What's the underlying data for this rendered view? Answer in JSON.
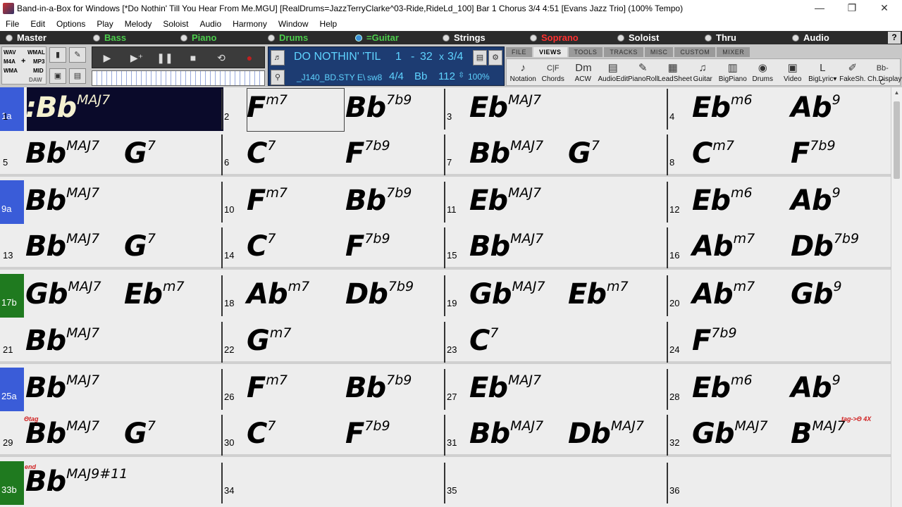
{
  "window": {
    "title": "Band-in-a-Box for Windows  [*Do Nothin' Till You Hear From Me.MGU] [RealDrums=JazzTerryClarke^03-Ride,RideLd_100] Bar 1 Chorus 3/4   4:51  [Evans Jazz Trio] (100% Tempo)",
    "minimize": "—",
    "restore": "❐",
    "close": "✕"
  },
  "menu": [
    "File",
    "Edit",
    "Options",
    "Play",
    "Melody",
    "Soloist",
    "Audio",
    "Harmony",
    "Window",
    "Help"
  ],
  "tracks": [
    {
      "label": "Master",
      "color": "#ffffff",
      "selected": false
    },
    {
      "label": "Bass",
      "color": "#4ccd4c",
      "selected": false
    },
    {
      "label": "Piano",
      "color": "#4ccd4c",
      "selected": false
    },
    {
      "label": "Drums",
      "color": "#4ccd4c",
      "selected": false
    },
    {
      "label": "=Guitar",
      "color": "#4ccd4c",
      "selected": true
    },
    {
      "label": "Strings",
      "color": "#ffffff",
      "selected": false
    },
    {
      "label": "Soprano",
      "color": "#ff3030",
      "selected": false
    },
    {
      "label": "Soloist",
      "color": "#ffffff",
      "selected": false
    },
    {
      "label": "Thru",
      "color": "#ffffff",
      "selected": false
    },
    {
      "label": "Audio",
      "color": "#ffffff",
      "selected": false
    }
  ],
  "help": "?",
  "formats": {
    "wav": "WAV",
    "wmal": "WMAL",
    "m4a": "M4A",
    "mp3": "MP3",
    "wma": "WMA",
    "mid": "MID",
    "daw": "DAW",
    "plus": "+"
  },
  "song": {
    "title": "DO NOTHIN' 'TIL",
    "bar_start": "1",
    "dash": "-",
    "bar_end": "32",
    "times": "x",
    "choruses": "3/4",
    "style": "_J140_BD.STY E\\",
    "style_var": "sw8",
    "time_sig": "4/4",
    "key": "Bb",
    "tempo": "112",
    "tempo_pct": "100%"
  },
  "tabs": [
    "FILE",
    "VIEWS",
    "TOOLS",
    "TRACKS",
    "MISC",
    "CUSTOM",
    "MIXER"
  ],
  "active_tab": "VIEWS",
  "views": [
    {
      "label": "Notation",
      "icon": "♪",
      "name": "notation-icon"
    },
    {
      "label": "Chords",
      "icon": "C|F",
      "name": "chords-icon"
    },
    {
      "label": "ACW",
      "icon": "Dm",
      "name": "acw-icon"
    },
    {
      "label": "AudioEdit",
      "icon": "▤",
      "name": "audioedit-icon"
    },
    {
      "label": "PianoRoll",
      "icon": "✎",
      "name": "pianoroll-icon"
    },
    {
      "label": "LeadSheet",
      "icon": "▦",
      "name": "leadsheet-icon"
    },
    {
      "label": "Guitar",
      "icon": "♫",
      "name": "guitar-icon"
    },
    {
      "label": "BigPiano",
      "icon": "▥",
      "name": "bigpiano-icon"
    },
    {
      "label": "Drums",
      "icon": "◉",
      "name": "drums-icon"
    },
    {
      "label": "Video",
      "icon": "▣",
      "name": "video-icon"
    },
    {
      "label": "BigLyric▾",
      "icon": "L",
      "name": "biglyric-icon"
    },
    {
      "label": "FakeSh.",
      "icon": "✐",
      "name": "fakesheet-icon"
    },
    {
      "label": "Ch.Display▾",
      "icon": "Bb-C",
      "name": "chord-display-icon"
    }
  ],
  "sheet": {
    "rows": [
      {
        "label": "1a",
        "label_color": "#3a5cd8",
        "bars": [
          {
            "num": "1",
            "chords": [
              {
                "root": ":Bb",
                "ext": "MAJ7"
              }
            ]
          },
          {
            "num": "2",
            "chords": [
              {
                "root": "F",
                "ext": "m7"
              },
              {
                "root": "Bb",
                "ext": "7b9"
              }
            ]
          },
          {
            "num": "3",
            "chords": [
              {
                "root": "Eb",
                "ext": "MAJ7"
              }
            ]
          },
          {
            "num": "4",
            "chords": [
              {
                "root": "Eb",
                "ext": "m6"
              },
              {
                "root": "Ab",
                "ext": "9"
              }
            ]
          }
        ]
      },
      {
        "label": "",
        "label_color": "",
        "bars": [
          {
            "num": "5",
            "chords": [
              {
                "root": "Bb",
                "ext": "MAJ7"
              },
              {
                "root": "G",
                "ext": "7"
              }
            ]
          },
          {
            "num": "6",
            "chords": [
              {
                "root": "C",
                "ext": "7"
              },
              {
                "root": "F",
                "ext": "7b9"
              }
            ]
          },
          {
            "num": "7",
            "chords": [
              {
                "root": "Bb",
                "ext": "MAJ7"
              },
              {
                "root": "G",
                "ext": "7"
              }
            ]
          },
          {
            "num": "8",
            "chords": [
              {
                "root": "C",
                "ext": "m7"
              },
              {
                "root": "F",
                "ext": "7b9"
              }
            ]
          }
        ]
      },
      {
        "label": "9a",
        "label_color": "#3a5cd8",
        "bars": [
          {
            "num": "",
            "chords": [
              {
                "root": "Bb",
                "ext": "MAJ7"
              }
            ]
          },
          {
            "num": "10",
            "chords": [
              {
                "root": "F",
                "ext": "m7"
              },
              {
                "root": "Bb",
                "ext": "7b9"
              }
            ]
          },
          {
            "num": "11",
            "chords": [
              {
                "root": "Eb",
                "ext": "MAJ7"
              }
            ]
          },
          {
            "num": "12",
            "chords": [
              {
                "root": "Eb",
                "ext": "m6"
              },
              {
                "root": "Ab",
                "ext": "9"
              }
            ]
          }
        ]
      },
      {
        "label": "",
        "label_color": "",
        "bars": [
          {
            "num": "13",
            "chords": [
              {
                "root": "Bb",
                "ext": "MAJ7"
              },
              {
                "root": "G",
                "ext": "7"
              }
            ]
          },
          {
            "num": "14",
            "chords": [
              {
                "root": "C",
                "ext": "7"
              },
              {
                "root": "F",
                "ext": "7b9"
              }
            ]
          },
          {
            "num": "15",
            "chords": [
              {
                "root": "Bb",
                "ext": "MAJ7"
              }
            ]
          },
          {
            "num": "16",
            "chords": [
              {
                "root": "Ab",
                "ext": "m7"
              },
              {
                "root": "Db",
                "ext": "7b9"
              }
            ]
          }
        ]
      },
      {
        "label": "17b",
        "label_color": "#1f7a1f",
        "bars": [
          {
            "num": "",
            "chords": [
              {
                "root": "Gb",
                "ext": "MAJ7"
              },
              {
                "root": "Eb",
                "ext": "m7"
              }
            ]
          },
          {
            "num": "18",
            "chords": [
              {
                "root": "Ab",
                "ext": "m7"
              },
              {
                "root": "Db",
                "ext": "7b9"
              }
            ]
          },
          {
            "num": "19",
            "chords": [
              {
                "root": "Gb",
                "ext": "MAJ7"
              },
              {
                "root": "Eb",
                "ext": "m7"
              }
            ]
          },
          {
            "num": "20",
            "chords": [
              {
                "root": "Ab",
                "ext": "m7"
              },
              {
                "root": "Gb",
                "ext": "9"
              }
            ]
          }
        ]
      },
      {
        "label": "",
        "label_color": "",
        "bars": [
          {
            "num": "21",
            "chords": [
              {
                "root": "Bb",
                "ext": "MAJ7"
              }
            ]
          },
          {
            "num": "22",
            "chords": [
              {
                "root": "G",
                "ext": "m7"
              }
            ]
          },
          {
            "num": "23",
            "chords": [
              {
                "root": "C",
                "ext": "7"
              }
            ]
          },
          {
            "num": "24",
            "chords": [
              {
                "root": "F",
                "ext": "7b9"
              }
            ]
          }
        ]
      },
      {
        "label": "25a",
        "label_color": "#3a5cd8",
        "bars": [
          {
            "num": "",
            "chords": [
              {
                "root": "Bb",
                "ext": "MAJ7"
              }
            ]
          },
          {
            "num": "26",
            "chords": [
              {
                "root": "F",
                "ext": "m7"
              },
              {
                "root": "Bb",
                "ext": "7b9"
              }
            ]
          },
          {
            "num": "27",
            "chords": [
              {
                "root": "Eb",
                "ext": "MAJ7"
              }
            ]
          },
          {
            "num": "28",
            "chords": [
              {
                "root": "Eb",
                "ext": "m6"
              },
              {
                "root": "Ab",
                "ext": "9"
              }
            ]
          }
        ]
      },
      {
        "label": "",
        "label_color": "",
        "bars": [
          {
            "num": "29",
            "chords": [
              {
                "root": "Bb",
                "ext": "MAJ7"
              },
              {
                "root": "G",
                "ext": "7"
              }
            ]
          },
          {
            "num": "30",
            "chords": [
              {
                "root": "C",
                "ext": "7"
              },
              {
                "root": "F",
                "ext": "7b9"
              }
            ]
          },
          {
            "num": "31",
            "chords": [
              {
                "root": "Bb",
                "ext": "MAJ7"
              },
              {
                "root": "Db",
                "ext": "MAJ7"
              }
            ]
          },
          {
            "num": "32",
            "chords": [
              {
                "root": "Gb",
                "ext": "MAJ7"
              },
              {
                "root": "B",
                "ext": "MAJ7"
              }
            ]
          }
        ]
      },
      {
        "label": "33b",
        "label_color": "#1f7a1f",
        "bars": [
          {
            "num": "",
            "chords": [
              {
                "root": "Bb",
                "ext": "MAJ9#11"
              }
            ]
          },
          {
            "num": "34",
            "chords": []
          },
          {
            "num": "35",
            "chords": []
          },
          {
            "num": "36",
            "chords": []
          }
        ]
      }
    ],
    "tags": {
      "tag_start": "Θtag",
      "tag_end": "tag->Θ 4X",
      "end": "end"
    }
  }
}
